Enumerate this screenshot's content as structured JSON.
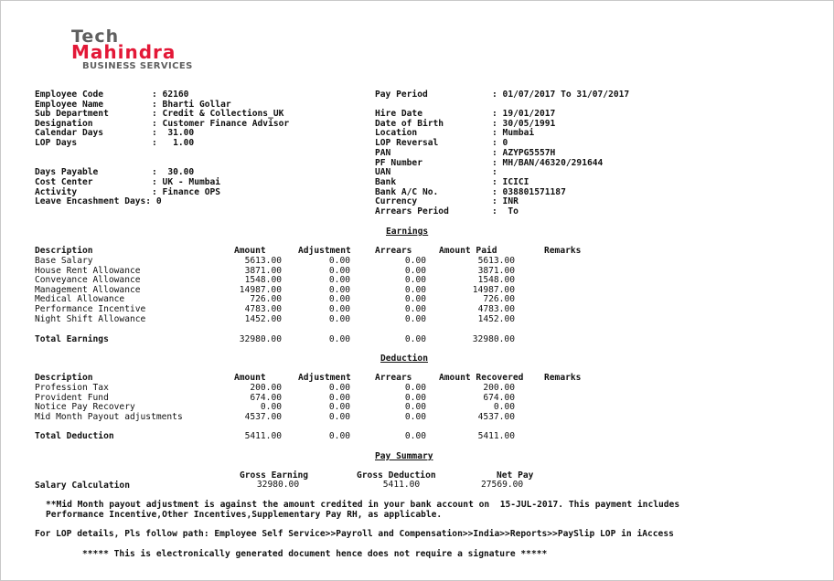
{
  "logo": {
    "line1": "Tech",
    "line2": "Mahindra",
    "line3": "BUSINESS SERVICES",
    "brand_red": "#e31837",
    "brand_gray": "#5f5f5f"
  },
  "employee_left_top": [
    {
      "label": "Employee Code",
      "value": ": 62160"
    },
    {
      "label": "Employee Name",
      "value": ": Bharti Gollar"
    },
    {
      "label": "Sub Department",
      "value": ": Credit & Collections_UK"
    },
    {
      "label": "Designation",
      "value": ": Customer Finance Advisor"
    },
    {
      "label": "Calendar Days",
      "value": ":  31.00"
    },
    {
      "label": "LOP Days",
      "value": ":   1.00"
    }
  ],
  "employee_left_bottom": [
    {
      "label": "Days Payable",
      "value": ":  30.00"
    },
    {
      "label": "Cost Center",
      "value": ": UK - Mumbai"
    },
    {
      "label": "Activity",
      "value": ": Finance OPS"
    }
  ],
  "leave_encashment": "Leave Encashment Days: 0",
  "pay_period": {
    "label": "Pay Period",
    "value": ": 01/07/2017 To 31/07/2017"
  },
  "employee_right": [
    {
      "label": "Hire Date",
      "value": ": 19/01/2017"
    },
    {
      "label": "Date of Birth",
      "value": ": 30/05/1991"
    },
    {
      "label": "Location",
      "value": ": Mumbai"
    },
    {
      "label": "LOP Reversal",
      "value": ": 0"
    },
    {
      "label": "PAN",
      "value": ": AZYPG5557H"
    },
    {
      "label": "PF Number",
      "value": ": MH/BAN/46320/291644"
    },
    {
      "label": "UAN",
      "value": ":"
    },
    {
      "label": "Bank",
      "value": ": ICICI"
    },
    {
      "label": "Bank A/C No.",
      "value": ": 038801571187"
    },
    {
      "label": "Currency",
      "value": ": INR"
    },
    {
      "label": "Arrears Period",
      "value": ":  To"
    }
  ],
  "earnings": {
    "title": "Earnings",
    "headers": {
      "description": "Description",
      "amount": "Amount",
      "adjustment": "Adjustment",
      "arrears": "Arrears",
      "paid": "Amount Paid",
      "remarks": "Remarks"
    },
    "rows": [
      {
        "description": "Base Salary",
        "amount": "5613.00",
        "adjustment": "0.00",
        "arrears": "0.00",
        "paid": "5613.00"
      },
      {
        "description": "House Rent Allowance",
        "amount": "3871.00",
        "adjustment": "0.00",
        "arrears": "0.00",
        "paid": "3871.00"
      },
      {
        "description": "Conveyance Allowance",
        "amount": "1548.00",
        "adjustment": "0.00",
        "arrears": "0.00",
        "paid": "1548.00"
      },
      {
        "description": "Management Allowance",
        "amount": "14987.00",
        "adjustment": "0.00",
        "arrears": "0.00",
        "paid": "14987.00"
      },
      {
        "description": "Medical Allowance",
        "amount": "726.00",
        "adjustment": "0.00",
        "arrears": "0.00",
        "paid": "726.00"
      },
      {
        "description": "Performance Incentive",
        "amount": "4783.00",
        "adjustment": "0.00",
        "arrears": "0.00",
        "paid": "4783.00"
      },
      {
        "description": "Night Shift Allowance",
        "amount": "1452.00",
        "adjustment": "0.00",
        "arrears": "0.00",
        "paid": "1452.00"
      }
    ],
    "total": {
      "label": "Total Earnings",
      "amount": "32980.00",
      "adjustment": "0.00",
      "arrears": "0.00",
      "paid": "32980.00"
    }
  },
  "deduction": {
    "title": "Deduction",
    "headers": {
      "description": "Description",
      "amount": "Amount",
      "adjustment": "Adjustment",
      "arrears": "Arrears",
      "recovered": "Amount Recovered",
      "remarks": "Remarks"
    },
    "rows": [
      {
        "description": "Profession Tax",
        "amount": "200.00",
        "adjustment": "0.00",
        "arrears": "0.00",
        "recovered": "200.00"
      },
      {
        "description": "Provident Fund",
        "amount": "674.00",
        "adjustment": "0.00",
        "arrears": "0.00",
        "recovered": "674.00"
      },
      {
        "description": "Notice Pay Recovery",
        "amount": "0.00",
        "adjustment": "0.00",
        "arrears": "0.00",
        "recovered": "0.00"
      },
      {
        "description": "Mid Month Payout adjustments",
        "amount": "4537.00",
        "adjustment": "0.00",
        "arrears": "0.00",
        "recovered": "4537.00"
      }
    ],
    "total": {
      "label": "Total Deduction",
      "amount": "5411.00",
      "adjustment": "0.00",
      "arrears": "0.00",
      "recovered": "5411.00"
    }
  },
  "pay_summary": {
    "title": "Pay Summary",
    "gross_earning_label": "Gross Earning",
    "gross_deduction_label": "Gross Deduction",
    "net_pay_label": "Net Pay",
    "row_label": "Salary Calculation",
    "gross_earning": "32980.00",
    "gross_deduction": "5411.00",
    "net_pay": "27569.00"
  },
  "notes": {
    "mid_month_line1": "**Mid Month payout adjustment is against the amount credited in your bank account on  15-JUL-2017. This payment includes",
    "mid_month_line2": "Performance Incentive,Other Incentives,Supplementary Pay RH, as applicable.",
    "lop_details": "For LOP details, Pls follow path: Employee Self Service>>Payroll and Compensation>>India>>Reports>>PaySlip LOP in iAccess",
    "signature": "***** This is electronically generated document hence does not require a signature *****"
  }
}
